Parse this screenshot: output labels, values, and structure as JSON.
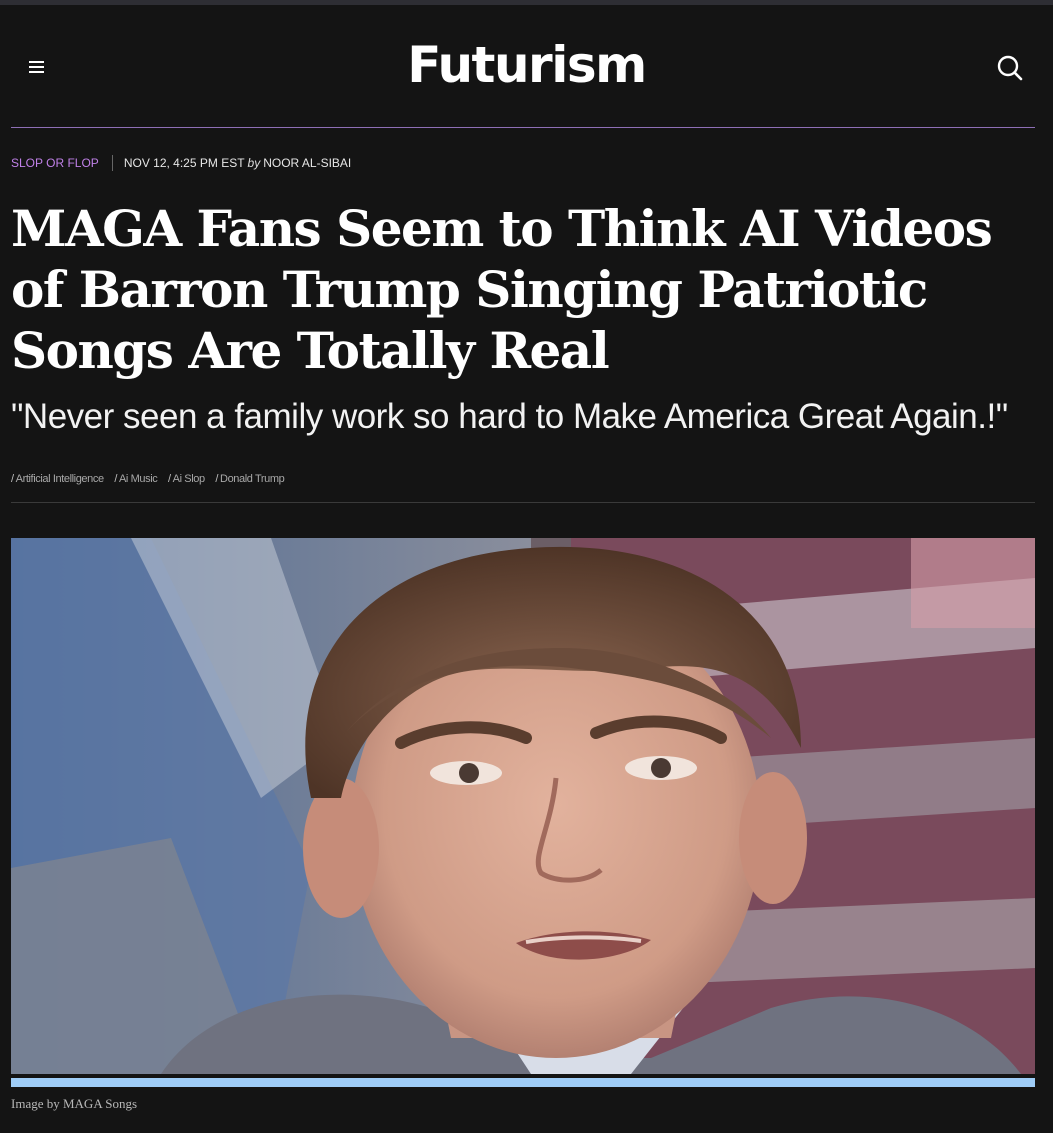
{
  "header": {
    "logo_text": "Futurism",
    "menu_icon": "hamburger-menu-icon",
    "search_icon": "search-icon"
  },
  "article": {
    "kicker": "SLOP OR FLOP",
    "date": "NOV 12, 4:25 PM EST",
    "by": "by",
    "author": "NOOR AL-SIBAI",
    "headline": "MAGA Fans Seem to Think AI Videos of Barron Trump Singing Patriotic Songs Are Totally Real",
    "subhead": "\"Never seen a family work so hard to Make America Great Again.!\"",
    "tags": [
      "Artificial Intelligence",
      "Ai Music",
      "Ai Slop",
      "Donald Trump"
    ],
    "image_caption": "Image by MAGA Songs"
  },
  "colors": {
    "background": "#141414",
    "accent_purple": "#c081e8",
    "rule_purple": "#8e6fb6",
    "image_bar_blue": "#9fcdf7"
  }
}
